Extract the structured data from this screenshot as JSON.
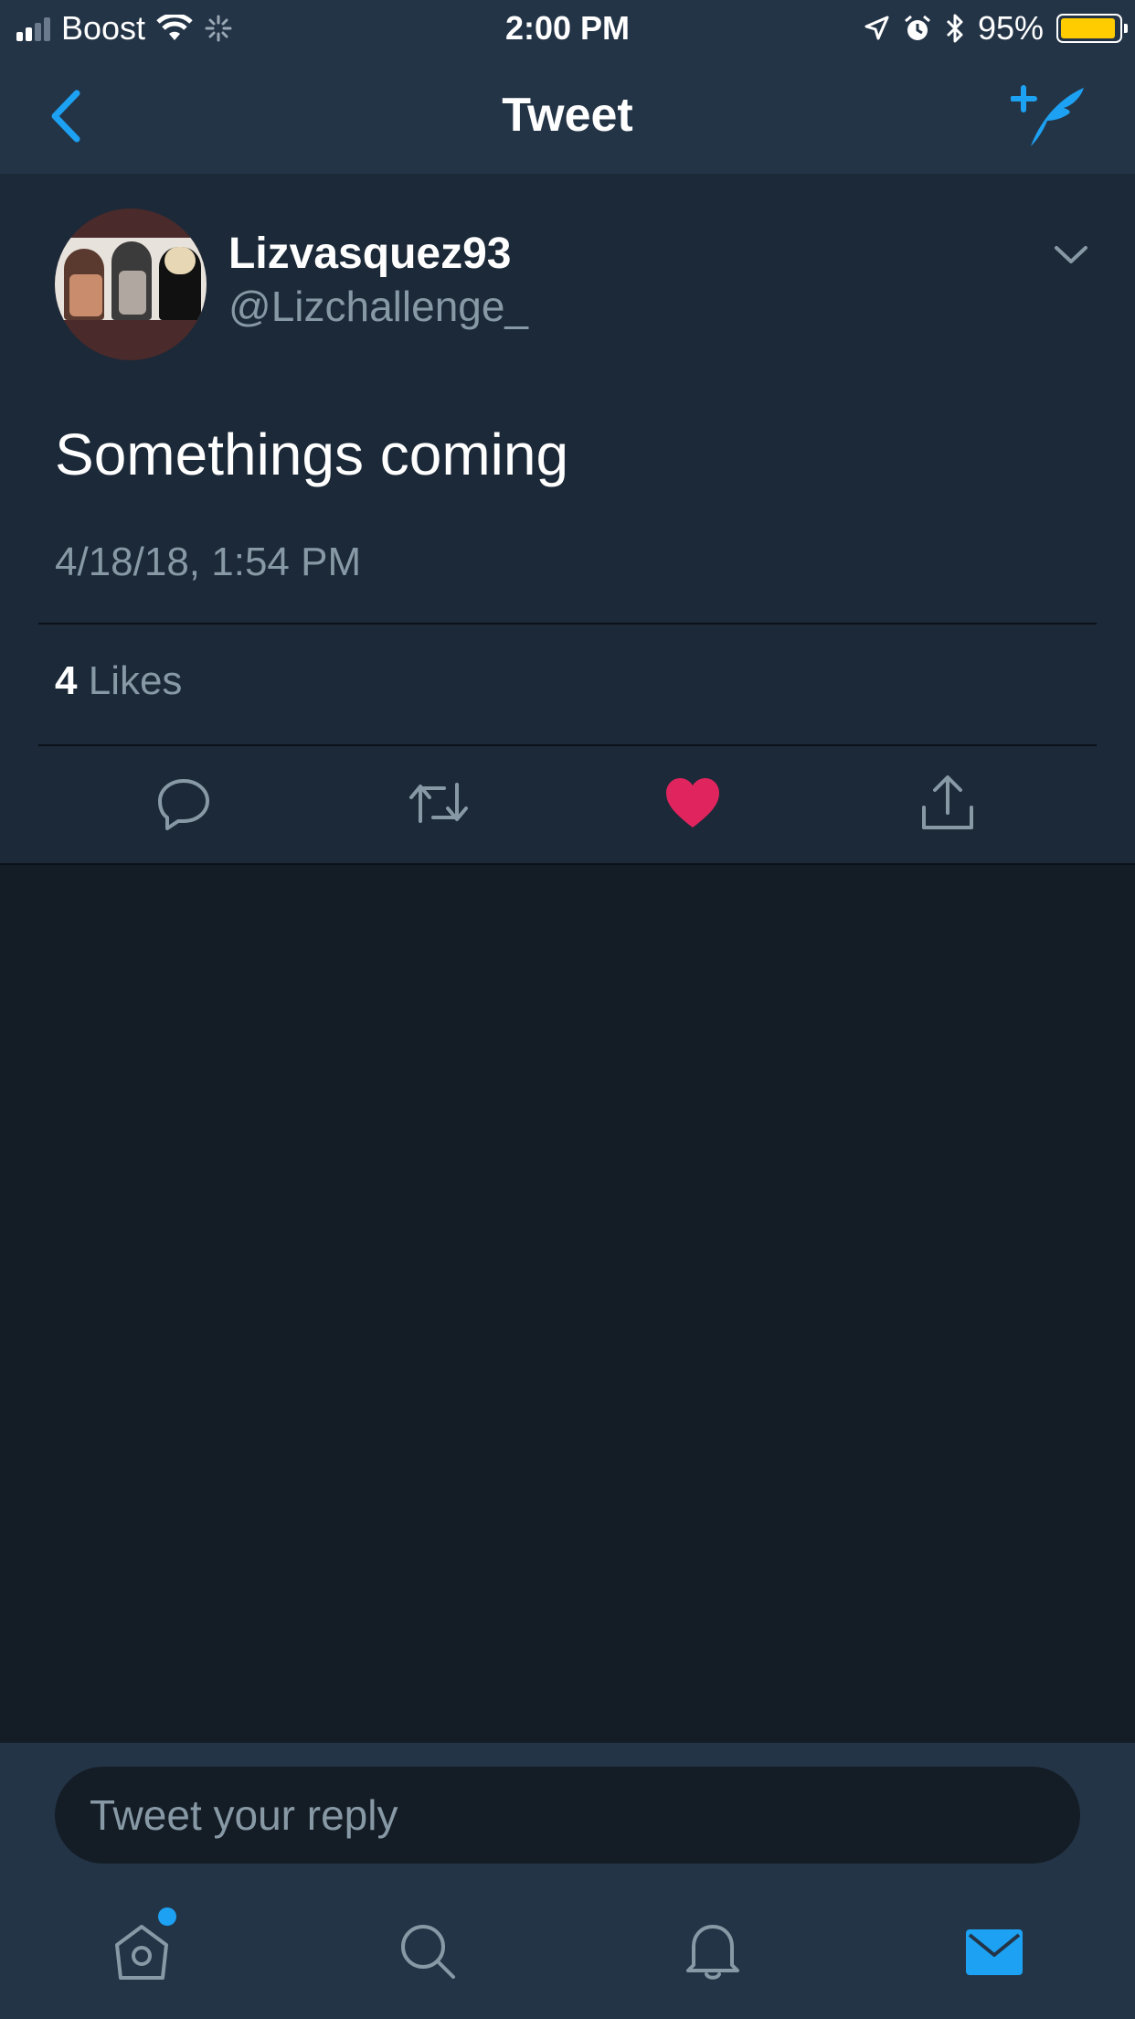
{
  "status_bar": {
    "carrier": "Boost",
    "time": "2:00 PM",
    "battery_percent": "95%",
    "battery_level": 0.95,
    "battery_color": "#ffcc00",
    "icons": [
      "signal-icon",
      "wifi-icon",
      "activity-spinner-icon",
      "location-arrow-icon",
      "alarm-icon",
      "bluetooth-icon",
      "battery-icon"
    ]
  },
  "nav": {
    "title": "Tweet",
    "back_icon": "chevron-left-icon",
    "compose_icon": "compose-tweet-icon",
    "accent_color": "#1da1f2"
  },
  "tweet": {
    "display_name": "Lizvasquez93",
    "handle": "@Lizchallenge_",
    "text": "Somethings coming",
    "timestamp": "4/18/18, 1:54 PM",
    "likes_count": "4",
    "likes_label": "Likes",
    "liked": true,
    "like_color": "#e0245e",
    "action_icons": [
      "reply-icon",
      "retweet-icon",
      "like-heart-icon",
      "share-icon"
    ]
  },
  "reply": {
    "placeholder": "Tweet your reply"
  },
  "tab_bar": {
    "tabs": [
      "home-icon",
      "search-icon",
      "notifications-icon",
      "messages-icon"
    ],
    "active_tab": "messages",
    "home_has_notification_dot": true
  }
}
